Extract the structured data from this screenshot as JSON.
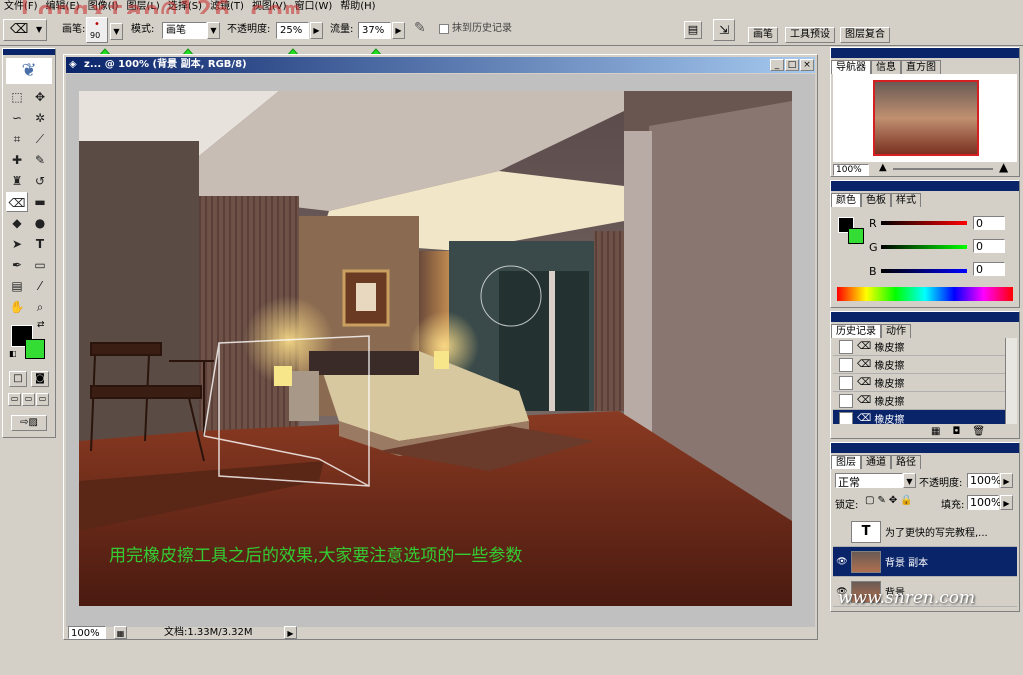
{
  "menu": [
    "文件(F)",
    "编辑(E)",
    "图像(I)",
    "图层(L)",
    "选择(S)",
    "滤镜(T)",
    "视图(V)",
    "窗口(W)",
    "帮助(H)"
  ],
  "watermark_top": "Longxtao@126.com",
  "options": {
    "brush_label": "画笔:",
    "brush_size": "90",
    "mode_label": "模式:",
    "mode_value": "画笔",
    "opacity_label": "不透明度:",
    "opacity_value": "25%",
    "flow_label": "流量:",
    "flow_value": "37%",
    "erase_history_label": "抹到历史记录"
  },
  "workspace_tabs": [
    "画笔",
    "工具预设",
    "图层复合"
  ],
  "document": {
    "title": "z... @ 100% (背景 副本, RGB/8)",
    "annotation": "用完橡皮擦工具之后的效果,大家要注意选项的一些参数",
    "zoom": "100%",
    "doc_info": "文档:1.33M/3.32M"
  },
  "navigator": {
    "tabs": [
      "导航器",
      "信息",
      "直方图"
    ],
    "zoom": "100%"
  },
  "color": {
    "tabs": [
      "颜色",
      "色板",
      "样式"
    ],
    "r_label": "R",
    "r_value": "0",
    "g_label": "G",
    "g_value": "0",
    "b_label": "B",
    "b_value": "0",
    "background_color": "#33dd33"
  },
  "history": {
    "tabs": [
      "历史记录",
      "动作"
    ],
    "items": [
      "橡皮擦",
      "橡皮擦",
      "橡皮擦",
      "橡皮擦",
      "橡皮擦"
    ]
  },
  "layers": {
    "tabs": [
      "图层",
      "通道",
      "路径"
    ],
    "blend": "正常",
    "opacity_label": "不透明度:",
    "opacity_value": "100%",
    "lock_label": "锁定:",
    "fill_label": "填充:",
    "fill_value": "100%",
    "items": [
      {
        "name": "为了更快的写完教程,..."
      },
      {
        "name": "背景 副本"
      },
      {
        "name": "背景"
      }
    ]
  },
  "site_watermark": "www.snren.com"
}
